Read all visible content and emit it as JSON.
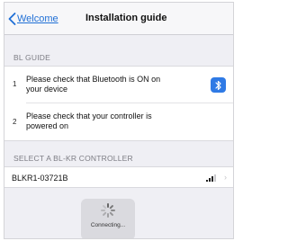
{
  "nav": {
    "back_label": "Welcome",
    "title": "Installation guide"
  },
  "guide": {
    "header": "BL GUIDE",
    "steps": [
      {
        "number": "1",
        "line1": "Please check that Bluetooth is ON on",
        "line2": "your device",
        "icon": "bluetooth-icon"
      },
      {
        "number": "2",
        "line1": "Please check that your controller is",
        "line2": "powered on"
      }
    ]
  },
  "controllers": {
    "header": "SELECT A BL-KR CONTROLLER",
    "items": [
      {
        "name": "BLKR1-03721B",
        "signal_icon": "signal-strength-icon",
        "signal_level": 0.75
      }
    ]
  },
  "hud": {
    "label": "Connecting..."
  },
  "colors": {
    "accent": "#1f6fd6",
    "bluetooth_badge": "#2f7ae5",
    "background": "#efeff4"
  }
}
